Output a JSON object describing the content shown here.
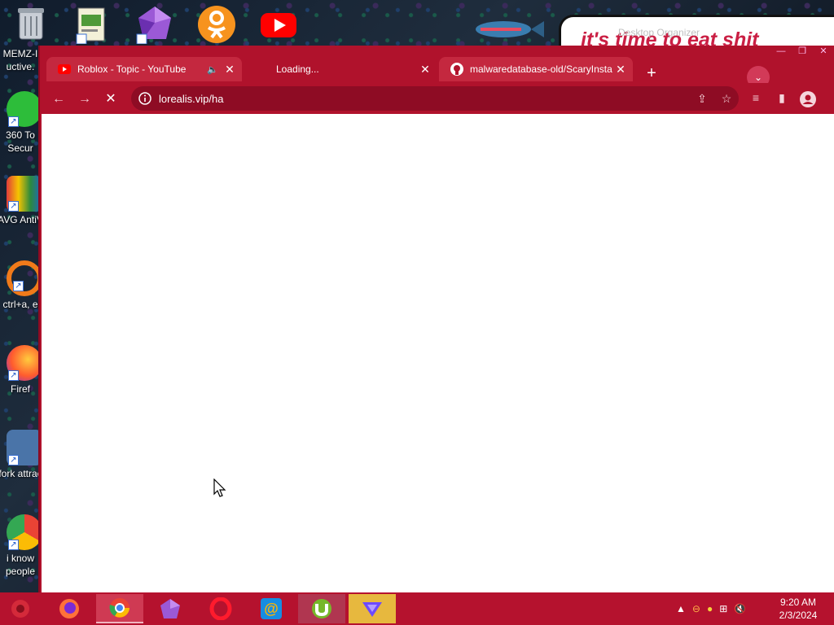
{
  "desktop": {
    "icons": [
      {
        "label": "MEMZ-I uctive."
      },
      {
        "label": "360 To Secur"
      },
      {
        "label": "AVG AntiV"
      },
      {
        "label": "ctrl+a, e"
      },
      {
        "label": "Firef"
      },
      {
        "label": "fork attrac"
      },
      {
        "label": "i know people"
      }
    ],
    "organizer": {
      "title": "Desktop Organizer",
      "graffiti": "it's time to eat shit"
    }
  },
  "browser": {
    "tabs": [
      {
        "title": "Roblox - Topic - YouTube",
        "favicon": "youtube-icon",
        "audio": true,
        "active": false
      },
      {
        "title": "Loading...",
        "favicon": "none",
        "audio": false,
        "active": true
      },
      {
        "title": "malwaredatabase-old/ScaryInsta",
        "favicon": "github-icon",
        "audio": false,
        "active": false
      }
    ],
    "url": "lorealis.vip/ha",
    "loading": true
  },
  "taskbar": {
    "apps": [
      "firefox-icon",
      "chrome-icon",
      "gem-app-icon",
      "opera-icon",
      "mail-at-icon",
      "utorrent-icon",
      "proton-vpn-icon"
    ],
    "active_app": "chrome-icon"
  },
  "clock": {
    "time": "9:20 AM",
    "date": "2/3/2024"
  },
  "colors": {
    "theme_red": "#b0122c",
    "tab_inactive": "#c4283f",
    "omnibox": "#8e0c24",
    "taskbar": "#b5122e"
  }
}
